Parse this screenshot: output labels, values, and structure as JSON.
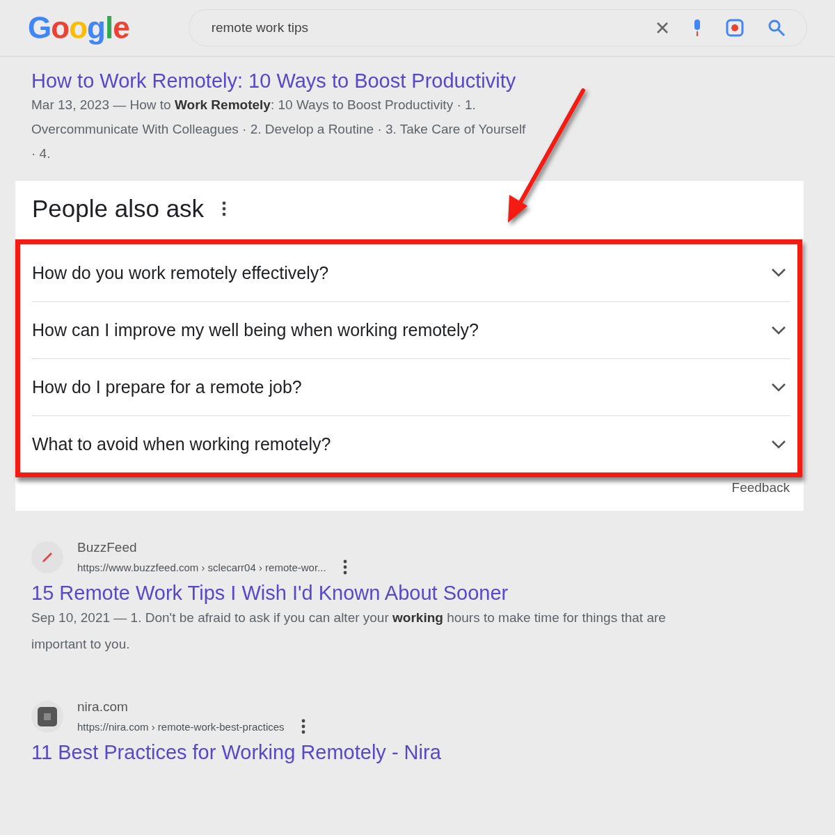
{
  "header": {
    "logo": "Google",
    "search": {
      "value": "remote work tips"
    }
  },
  "top_result": {
    "title": "How to Work Remotely: 10 Ways to Boost Productivity",
    "snippet": "Mar 13, 2023 — How to **Work Remotely**: 10 Ways to Boost Productivity · 1. Overcommunicate With Colleagues · 2. Develop a Routine · 3. Take Care of Yourself · 4."
  },
  "people_also_ask": {
    "title": "People also ask",
    "questions": [
      {
        "text": "How do you work remotely effectively?",
        "expanded": false
      },
      {
        "text": "How can I improve my well being when working remotely?",
        "expanded": false
      },
      {
        "text": "How do I prepare for a remote job?",
        "expanded": false
      },
      {
        "text": "What to avoid when working remotely?",
        "expanded": false
      }
    ],
    "feedback": "Feedback"
  },
  "results": [
    {
      "kind": "pen",
      "site": "BuzzFeed",
      "url": "https://www.buzzfeed.com › sclecarr04 › remote-wor...",
      "title": "15 Remote Work Tips I Wish I'd Known About Sooner",
      "snippet": "Sep 10, 2021 — 1. Don't be afraid to ask if you can alter your **working** hours to make time for things that are important to you."
    },
    {
      "kind": "square",
      "site": "nira.com",
      "url": "https://nira.com › remote-work-best-practices",
      "title": "11 Best Practices for Working Remotely - Nira"
    }
  ]
}
